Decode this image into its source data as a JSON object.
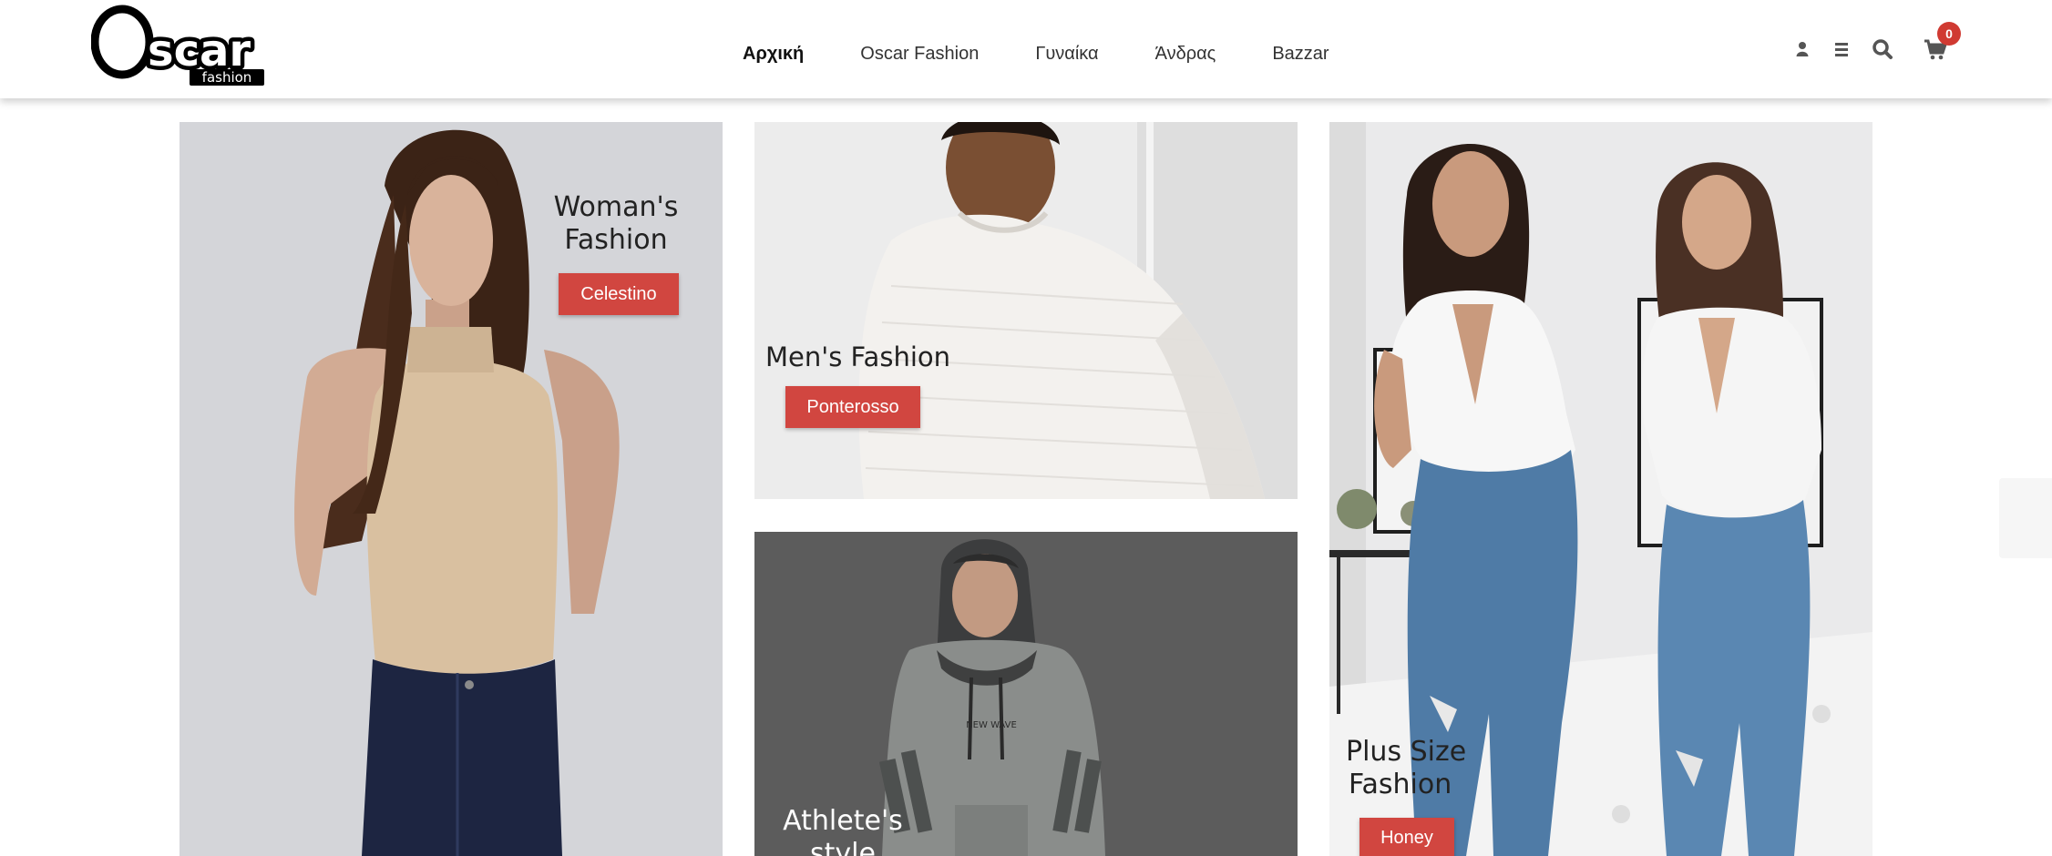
{
  "brand": {
    "logo_main": "Oscar",
    "logo_sub": "fashion"
  },
  "nav": {
    "items": [
      {
        "label": "Αρχική"
      },
      {
        "label": "Oscar Fashion"
      },
      {
        "label": "Γυναίκα"
      },
      {
        "label": "Άνδρας"
      },
      {
        "label": "Bazzar"
      }
    ]
  },
  "header_icons": [
    "user-icon",
    "menu-icon",
    "search-icon",
    "cart-icon"
  ],
  "cart": {
    "count": "0"
  },
  "tiles": {
    "women": {
      "title_line1": "Woman's",
      "title_line2": "Fashion",
      "button": "Celestino"
    },
    "men": {
      "title": "Men's Fashion",
      "button": "Ponterosso"
    },
    "athlete": {
      "title_line1": "Athlete's",
      "title_line2": "style"
    },
    "plus": {
      "title_line1": "Plus Size",
      "title_line2": "Fashion",
      "button": "Honey"
    }
  },
  "colors": {
    "accent": "#d14640",
    "badge": "#d03a32",
    "header_bg": "#ffffff"
  }
}
